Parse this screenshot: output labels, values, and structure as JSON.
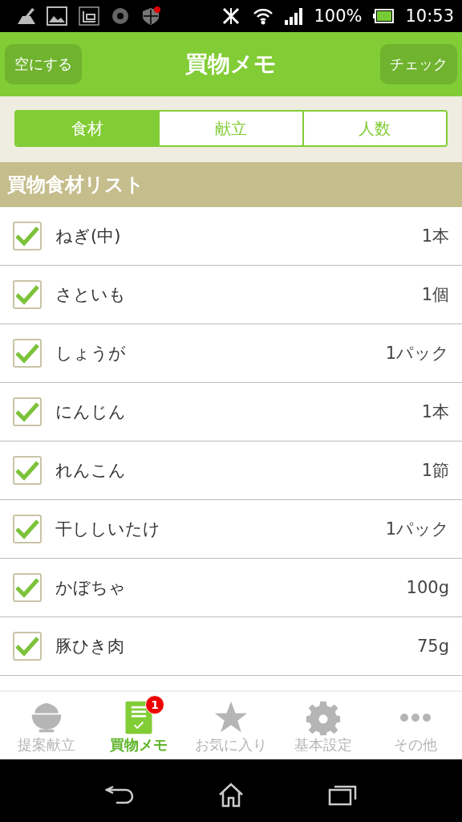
{
  "status_bar": {
    "battery": "100%",
    "time": "10:53"
  },
  "header": {
    "left_button": "空にする",
    "title": "買物メモ",
    "right_button": "チェック"
  },
  "tabs": [
    {
      "label": "食材",
      "selected": true
    },
    {
      "label": "献立",
      "selected": false
    },
    {
      "label": "人数",
      "selected": false
    }
  ],
  "section": {
    "title": "買物食材リスト"
  },
  "items": [
    {
      "name": "ねぎ(中)",
      "amount": "1本",
      "checked": true
    },
    {
      "name": "さといも",
      "amount": "1個",
      "checked": true
    },
    {
      "name": "しょうが",
      "amount": "1パック",
      "checked": true
    },
    {
      "name": "にんじん",
      "amount": "1本",
      "checked": true
    },
    {
      "name": "れんこん",
      "amount": "1節",
      "checked": true
    },
    {
      "name": "干ししいたけ",
      "amount": "1パック",
      "checked": true
    },
    {
      "name": "かぼちゃ",
      "amount": "100g",
      "checked": true
    },
    {
      "name": "豚ひき肉",
      "amount": "75g",
      "checked": true
    }
  ],
  "bottom_nav": [
    {
      "label": "提案献立",
      "selected": false
    },
    {
      "label": "買物メモ",
      "selected": true,
      "badge": "1"
    },
    {
      "label": "お気に入り",
      "selected": false
    },
    {
      "label": "基本設定",
      "selected": false
    },
    {
      "label": "その他",
      "selected": false
    }
  ]
}
